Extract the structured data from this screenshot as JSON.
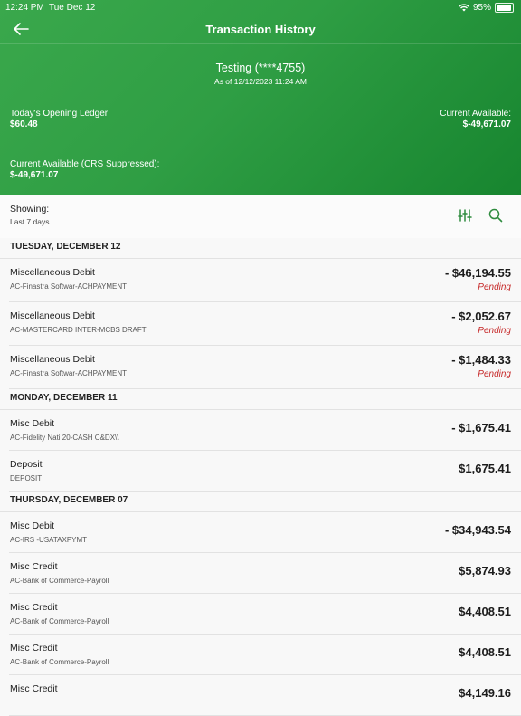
{
  "status_bar": {
    "time": "12:24 PM",
    "date": "Tue Dec 12",
    "battery": "95%",
    "battery_level": 0.95
  },
  "nav": {
    "title": "Transaction History"
  },
  "account": {
    "name": "Testing  (****4755)",
    "as_of": "As of 12/12/2023 11:24 AM",
    "opening_ledger_label": "Today's Opening Ledger:",
    "opening_ledger_value": "$60.48",
    "current_available_label": "Current Available:",
    "current_available_value": "$-49,671.07",
    "crs_label": "Current Available (CRS Suppressed):",
    "crs_value": "$-49,671.07"
  },
  "filter": {
    "showing_label": "Showing:",
    "showing_value": "Last 7 days"
  },
  "sections": [
    {
      "date": "TUESDAY, DECEMBER 12",
      "items": [
        {
          "title": "Miscellaneous Debit",
          "desc": "AC-Finastra Softwar-ACHPAYMENT",
          "amount": "- $46,194.55",
          "status": "Pending"
        },
        {
          "title": "Miscellaneous Debit",
          "desc": "AC-MASTERCARD INTER-MCBS DRAFT",
          "amount": "- $2,052.67",
          "status": "Pending"
        },
        {
          "title": "Miscellaneous Debit",
          "desc": "AC-Finastra Softwar-ACHPAYMENT",
          "amount": "- $1,484.33",
          "status": "Pending"
        }
      ]
    },
    {
      "date": "MONDAY, DECEMBER 11",
      "items": [
        {
          "title": "Misc Debit",
          "desc": "AC-Fidelity Nati 20-CASH C&DX\\\\",
          "amount": "- $1,675.41",
          "status": ""
        },
        {
          "title": "Deposit",
          "desc": "DEPOSIT",
          "amount": "$1,675.41",
          "status": ""
        }
      ]
    },
    {
      "date": "THURSDAY, DECEMBER 07",
      "items": [
        {
          "title": "Misc Debit",
          "desc": "AC-IRS -USATAXPYMT",
          "amount": "- $34,943.54",
          "status": ""
        },
        {
          "title": "Misc Credit",
          "desc": "AC-Bank of Commerce-Payroll",
          "amount": "$5,874.93",
          "status": ""
        },
        {
          "title": "Misc Credit",
          "desc": "AC-Bank of Commerce-Payroll",
          "amount": "$4,408.51",
          "status": ""
        },
        {
          "title": "Misc Credit",
          "desc": "AC-Bank of Commerce-Payroll",
          "amount": "$4,408.51",
          "status": ""
        },
        {
          "title": "Misc Credit",
          "desc": "",
          "amount": "$4,149.16",
          "status": ""
        }
      ]
    }
  ],
  "colors": {
    "header_green": "#2f9e44",
    "pending_red": "#c62828",
    "icon_green": "#2e8b3e"
  }
}
